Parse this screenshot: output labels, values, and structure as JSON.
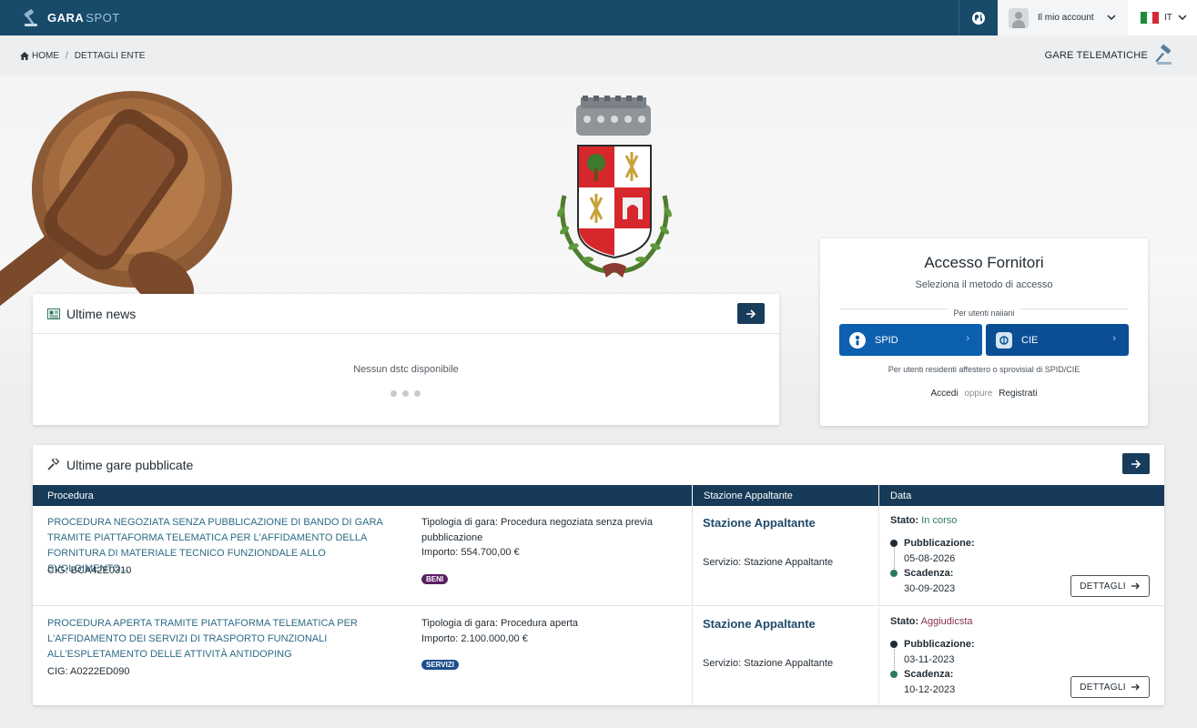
{
  "app": {
    "logo_primary": "GARA",
    "logo_secondary": "SPOT",
    "account_label": "Il mio account",
    "language": "IT"
  },
  "breadcrumb": {
    "home": "HOME",
    "current": "DETTAGLI ENTE"
  },
  "section_link": "GARE TELEMATICHE",
  "news": {
    "title": "Ultime news",
    "empty": "Nessun dstc disponibile"
  },
  "access": {
    "title": "Accesso Fornitori",
    "subtitle": "Seleziona il metodo di accesso",
    "note_italian": "Per utenti naiiani",
    "spid_label": "SPID",
    "cie_label": "CIE",
    "note_foreign": "Per utenti residenti affestero o sprovisial di SPID/CIE",
    "login_label": "Accedi",
    "or_label": "oppure",
    "register_label": "Registrati"
  },
  "gare": {
    "title": "Ultime gare pubblicate",
    "columns": {
      "procedura": "Procedura",
      "stazione": "Stazione Appaltante",
      "data": "Data"
    },
    "rows": [
      {
        "title": "PROCEDURA NEGOZIATA SENZA PUBBLICAZIONE DI BANDO DI GARA TRAMITE PIATTAFORMA TELEMATICA PER L'AFFIDAMENTO DELLA FORNITURA DI MATERIALE TECNICO FUNZIONDALE ALLO SVOLGIMENTO...",
        "cig": "CIG: BCA42E0310",
        "tipologia": "Tipologia di gara: Procedura negoziata senza previa pubblicazione",
        "importo": "Importo: 554.700,00 €",
        "badge": "BENI",
        "stazione": "Stazione Appaltante",
        "servizio": "Servizio: Stazione Appaltante",
        "stato_label": "Stato:",
        "stato_value": "In corso",
        "pubblicazione_label": "Pubblicazione:",
        "pubblicazione_date": "05-08-2026",
        "scadenza_label": "Scadenza:",
        "scadenza_date": "30-09-2023",
        "details_label": "DETTAGLI"
      },
      {
        "title": "PROCEDURA APERTA TRAMITE PIATTAFORMA TELEMATICA PER L'AFFIDAMENTO DEI SERVIZI DI TRASPORTO FUNZIONALI ALL'ESPLETAMENTO DELLE ATTIVITÀ ANTIDOPING",
        "cig": "CIG: A0222ED090",
        "tipologia": "Tipologia di gara: Procedura aperta",
        "importo": "Importo: 2.100.000,00 €",
        "badge": "SERVIZI",
        "stazione": "Stazione Appaltante",
        "servizio": "Servizio: Stazione Appaltante",
        "stato_label": "Stato:",
        "stato_value": "Aggiudicsta",
        "pubblicazione_label": "Pubblicazione:",
        "pubblicazione_date": "03-11-2023",
        "scadenza_label": "Scadenza:",
        "scadenza_date": "10-12-2023",
        "details_label": "DETTAGLI"
      }
    ]
  },
  "colors": {
    "topbar": "#184a6a",
    "table_header": "#173a58",
    "spid": "#0d5fb0",
    "cie": "#0a4f96",
    "link_title": "#2d6b86",
    "badge_beni": "#5b1f63",
    "badge_servizi": "#1e4f8a",
    "stato_in_corso": "#2d7a5e",
    "stato_aggiudicata": "#8a2f55"
  },
  "icons": [
    "gavel-logo-icon",
    "globe-icon",
    "user-icon",
    "chevron-down-icon",
    "italy-flag-icon",
    "home-icon",
    "gavel-section-icon",
    "news-icon",
    "arrow-right-icon",
    "spid-icon",
    "cie-icon",
    "chevron-right-icon",
    "hammer-icon"
  ]
}
